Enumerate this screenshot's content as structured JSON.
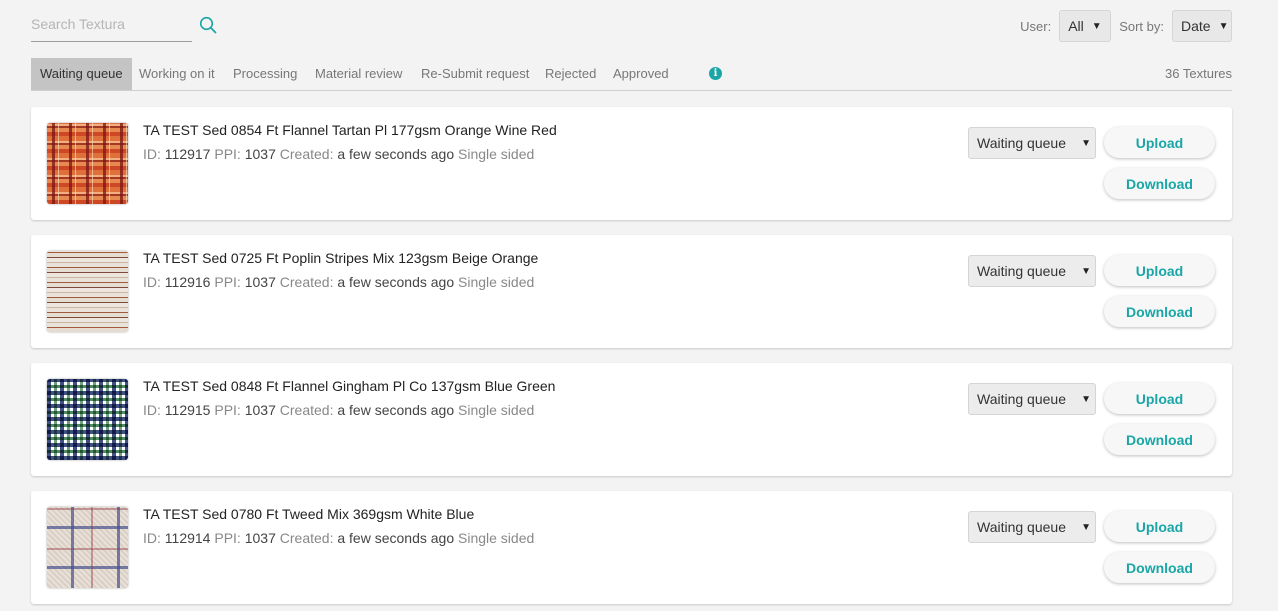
{
  "search": {
    "placeholder": "Search Textura",
    "value": ""
  },
  "filters": {
    "user_label": "User:",
    "user_value": "All",
    "sort_label": "Sort by:",
    "sort_value": "Date"
  },
  "tabs": [
    {
      "label": "Waiting queue",
      "active": true
    },
    {
      "label": "Working on it",
      "active": false
    },
    {
      "label": "Processing",
      "active": false
    },
    {
      "label": "Material review",
      "active": false
    },
    {
      "label": "Re-Submit request",
      "active": false
    },
    {
      "label": "Rejected",
      "active": false
    },
    {
      "label": "Approved",
      "active": false
    }
  ],
  "texture_count": "36 Textures",
  "labels": {
    "id": "ID:",
    "ppi": "PPI:",
    "created": "Created:",
    "upload": "Upload",
    "download": "Download"
  },
  "textures": [
    {
      "title": "TA TEST Sed 0854 Ft Flannel Tartan Pl 177gsm Orange Wine Red",
      "id": "112917",
      "ppi": "1037",
      "created": "a few seconds ago",
      "sided": "Single sided",
      "status": "Waiting queue"
    },
    {
      "title": "TA TEST Sed 0725 Ft Poplin Stripes Mix 123gsm Beige Orange",
      "id": "112916",
      "ppi": "1037",
      "created": "a few seconds ago",
      "sided": "Single sided",
      "status": "Waiting queue"
    },
    {
      "title": "TA TEST Sed 0848 Ft Flannel Gingham Pl Co 137gsm Blue Green",
      "id": "112915",
      "ppi": "1037",
      "created": "a few seconds ago",
      "sided": "Single sided",
      "status": "Waiting queue"
    },
    {
      "title": "TA TEST Sed 0780 Ft Tweed Mix 369gsm White Blue",
      "id": "112914",
      "ppi": "1037",
      "created": "a few seconds ago",
      "sided": "Single sided",
      "status": "Waiting queue"
    }
  ],
  "colors": {
    "accent": "#1aa6a6",
    "active_tab_bg": "#c4c4c4",
    "page_bg": "#f3f3f3"
  },
  "icons": {
    "search": "search-icon",
    "info": "info-icon",
    "select_arrow": "chevron-down-icon"
  }
}
